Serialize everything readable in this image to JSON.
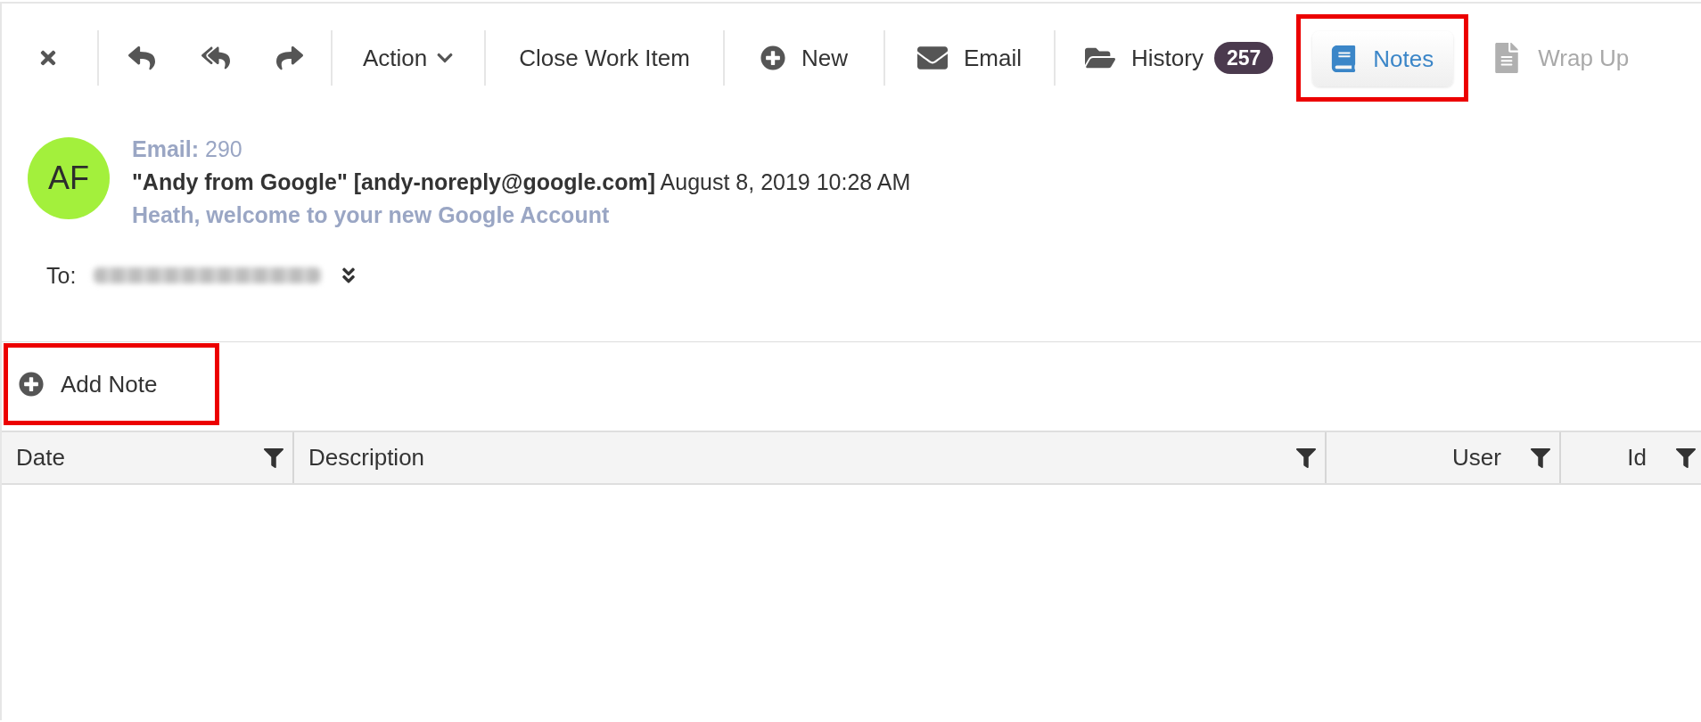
{
  "toolbar": {
    "action": {
      "label": "Action"
    },
    "close_work_item": {
      "label": "Close Work Item"
    },
    "new": {
      "label": "New"
    },
    "email": {
      "label": "Email",
      "selected": false,
      "disabled": false
    },
    "history": {
      "label": "History",
      "badge": "257",
      "selected": false,
      "disabled": false
    },
    "notes": {
      "label": "Notes",
      "selected": true,
      "disabled": false,
      "highlighted": true
    },
    "wrap_up": {
      "label": "Wrap Up",
      "selected": false,
      "disabled": true
    }
  },
  "email": {
    "avatar": {
      "initials": "AF"
    },
    "number": "**Email:** 290",
    "sender": "**\"Andy from Google\" [andy-noreply@google.com]** August 8, 2019 10:28 AM",
    "subject": "Heath, welcome to your new Google Account",
    "to_label": "To:"
  },
  "notes_panel": {
    "add_note": {
      "label": "Add Note",
      "highlighted": true
    },
    "table": {
      "columns": [
        {
          "label": "Date"
        },
        {
          "label": "Description"
        },
        {
          "label": "User"
        },
        {
          "label": "Id"
        }
      ]
    }
  }
}
